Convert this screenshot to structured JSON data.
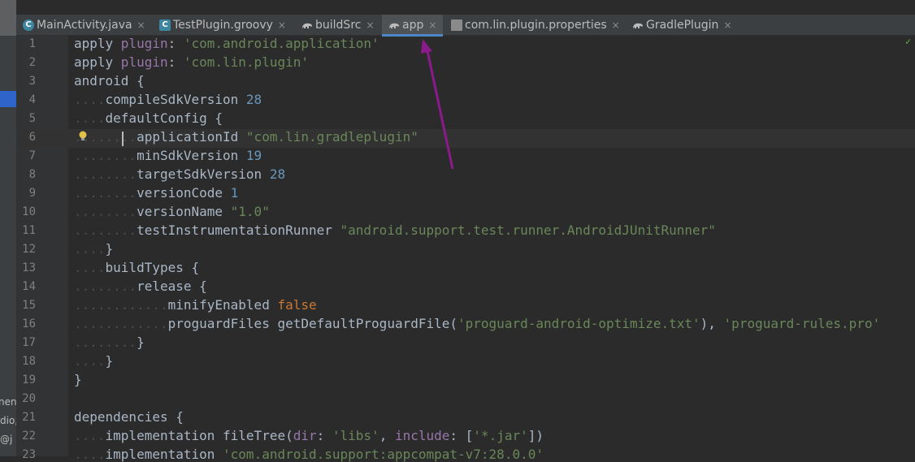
{
  "tabs": [
    {
      "label": "MainActivity.java",
      "icon": "class-icon",
      "active": false
    },
    {
      "label": "TestPlugin.groovy",
      "icon": "groovy-icon",
      "active": false
    },
    {
      "label": "buildSrc",
      "icon": "gradle-icon",
      "active": false
    },
    {
      "label": "app",
      "icon": "gradle-icon",
      "active": true
    },
    {
      "label": "com.lin.plugin.properties",
      "icon": "properties-icon",
      "active": false
    },
    {
      "label": "GradlePlugin",
      "icon": "gradle-icon",
      "active": false
    }
  ],
  "close_glyph": "×",
  "left_strip": {
    "fragments": [
      "nen",
      "dio,",
      "@j"
    ]
  },
  "line_numbers": [
    "1",
    "2",
    "3",
    "4",
    "5",
    "6",
    "7",
    "8",
    "9",
    "10",
    "11",
    "12",
    "13",
    "14",
    "15",
    "16",
    "17",
    "18",
    "19",
    "20",
    "21",
    "22",
    "23"
  ],
  "code_lines": [
    {
      "indent": 0,
      "tokens": [
        {
          "t": "apply "
        },
        {
          "t": "plugin",
          "c": "p"
        },
        {
          "t": ": "
        },
        {
          "t": "'com.android.application'"
        }
      ]
    },
    {
      "indent": 0,
      "tokens": [
        {
          "t": "apply "
        },
        {
          "t": "plugin",
          "c": "p"
        },
        {
          "t": ": "
        },
        {
          "t": "'com.lin.plugin'"
        }
      ]
    },
    {
      "indent": 0,
      "tokens": [
        {
          "t": "android {"
        }
      ]
    },
    {
      "indent": 1,
      "tokens": [
        {
          "t": "compileSdkVersion "
        },
        {
          "t": "28",
          "c": "n"
        }
      ]
    },
    {
      "indent": 1,
      "tokens": [
        {
          "t": "defaultConfig {"
        }
      ]
    },
    {
      "indent": 2,
      "tokens": [
        {
          "t": "applicationId "
        },
        {
          "t": "\"com.lin.gradleplugin\"",
          "c": "s"
        }
      ]
    },
    {
      "indent": 2,
      "tokens": [
        {
          "t": "minSdkVersion "
        },
        {
          "t": "19",
          "c": "n"
        }
      ]
    },
    {
      "indent": 2,
      "tokens": [
        {
          "t": "targetSdkVersion "
        },
        {
          "t": "28",
          "c": "n"
        }
      ]
    },
    {
      "indent": 2,
      "tokens": [
        {
          "t": "versionCode "
        },
        {
          "t": "1",
          "c": "n"
        }
      ]
    },
    {
      "indent": 2,
      "tokens": [
        {
          "t": "versionName "
        },
        {
          "t": "\"1.0\"",
          "c": "s"
        }
      ]
    },
    {
      "indent": 2,
      "tokens": [
        {
          "t": "testInstrumentationRunner "
        },
        {
          "t": "\"android.support.test.runner.AndroidJUnitRunner\"",
          "c": "s"
        }
      ]
    },
    {
      "indent": 1,
      "tokens": [
        {
          "t": "}"
        }
      ]
    },
    {
      "indent": 1,
      "tokens": [
        {
          "t": "buildTypes {"
        }
      ]
    },
    {
      "indent": 2,
      "tokens": [
        {
          "t": "release {"
        }
      ]
    },
    {
      "indent": 3,
      "tokens": [
        {
          "t": "minifyEnabled "
        },
        {
          "t": "false",
          "c": "k"
        }
      ]
    },
    {
      "indent": 3,
      "tokens": [
        {
          "t": "proguardFiles getDefaultProguardFile("
        },
        {
          "t": "'proguard-android-optimize.txt'"
        },
        {
          "t": "), "
        },
        {
          "t": "'proguard-rules.pro'"
        }
      ]
    },
    {
      "indent": 2,
      "tokens": [
        {
          "t": "}"
        }
      ]
    },
    {
      "indent": 1,
      "tokens": [
        {
          "t": "}"
        }
      ]
    },
    {
      "indent": 0,
      "tokens": [
        {
          "t": "}"
        }
      ]
    },
    {
      "indent": 0,
      "tokens": []
    },
    {
      "indent": 0,
      "tokens": [
        {
          "t": "dependencies {"
        }
      ]
    },
    {
      "indent": 1,
      "tokens": [
        {
          "t": "implementation fileTree("
        },
        {
          "t": "dir",
          "c": "p"
        },
        {
          "t": ": "
        },
        {
          "t": "'libs'"
        },
        {
          "t": ", "
        },
        {
          "t": "include",
          "c": "p"
        },
        {
          "t": ": ["
        },
        {
          "t": "'*.jar'"
        },
        {
          "t": "])"
        }
      ]
    },
    {
      "indent": 1,
      "tokens": [
        {
          "t": "implementation "
        },
        {
          "t": "'com.android.support:appcompat-v7:28.0.0'"
        }
      ]
    }
  ],
  "colors": {
    "editor_bg": "#2b2b2b",
    "annotation_arrow": "#8b1a8b",
    "tab_accent": "#4a88c7"
  }
}
